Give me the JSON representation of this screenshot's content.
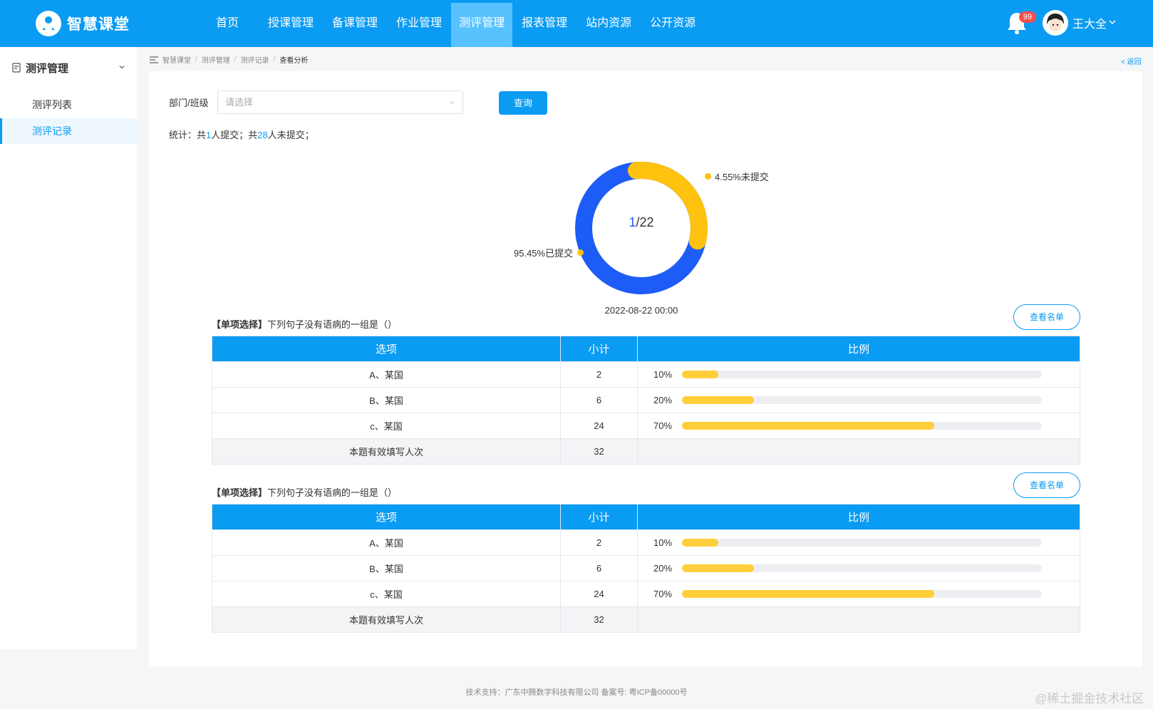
{
  "app": {
    "name": "智慧课堂"
  },
  "nav": {
    "items": [
      "首页",
      "授课管理",
      "备课管理",
      "作业管理",
      "测评管理",
      "报表管理",
      "站内资源",
      "公开资源"
    ],
    "active_index": 4
  },
  "user": {
    "name": "王大全",
    "notification_count": "99"
  },
  "sidebar": {
    "group": "测评管理",
    "items": [
      "测评列表",
      "测评记录"
    ],
    "active_index": 1
  },
  "breadcrumb": [
    "智慧课堂",
    "测评管理",
    "测评记录",
    "查看分析"
  ],
  "back_label": "< 返回",
  "filter": {
    "label": "部门/班级",
    "placeholder": "请选择",
    "query_label": "查询"
  },
  "stats": {
    "prefix": "统计：共",
    "submitted": "1",
    "mid": "人提交；共",
    "unsubmitted": "28",
    "suffix": "人未提交；"
  },
  "donut": {
    "center_highlight": "1",
    "center_rest": "/22",
    "submitted_fraction": 0.0455,
    "unsubmitted_label": "4.55%未提交",
    "submitted_label": "95.45%已提交",
    "date": "2022-08-22  00:00",
    "colors": {
      "track": "#1e5cf8",
      "segment": "#ffc20e",
      "dot": "#ffc20e"
    }
  },
  "questions": [
    {
      "tag": "【单项选择】",
      "text": "下列句子没有语病的一组是（）",
      "list_button": "查看名单",
      "headers": [
        "选项",
        "小计",
        "比例"
      ],
      "rows": [
        {
          "option": "A、某国",
          "count": "2",
          "ratio": "10%",
          "fraction": 0.1
        },
        {
          "option": "B、某国",
          "count": "6",
          "ratio": "20%",
          "fraction": 0.2
        },
        {
          "option": "c、某国",
          "count": "24",
          "ratio": "70%",
          "fraction": 0.7
        }
      ],
      "total_label": "本题有效填写人次",
      "total": "32"
    },
    {
      "tag": "【单项选择】",
      "text": "下列句子没有语病的一组是（）",
      "list_button": "查看名单",
      "headers": [
        "选项",
        "小计",
        "比例"
      ],
      "rows": [
        {
          "option": "A、某国",
          "count": "2",
          "ratio": "10%",
          "fraction": 0.1
        },
        {
          "option": "B、某国",
          "count": "6",
          "ratio": "20%",
          "fraction": 0.2
        },
        {
          "option": "c、某国",
          "count": "24",
          "ratio": "70%",
          "fraction": 0.7
        }
      ],
      "total_label": "本题有效填写人次",
      "total": "32"
    }
  ],
  "footer": "技术支持：广东中腾数字科技有限公司    备案号: 粤ICP备00000号",
  "watermark": "@稀土掘金技术社区",
  "colors": {
    "primary": "#0a9bf2",
    "nav_active": "#58c2ff",
    "bar": "#ffcf3b",
    "badge": "#f5504c"
  }
}
